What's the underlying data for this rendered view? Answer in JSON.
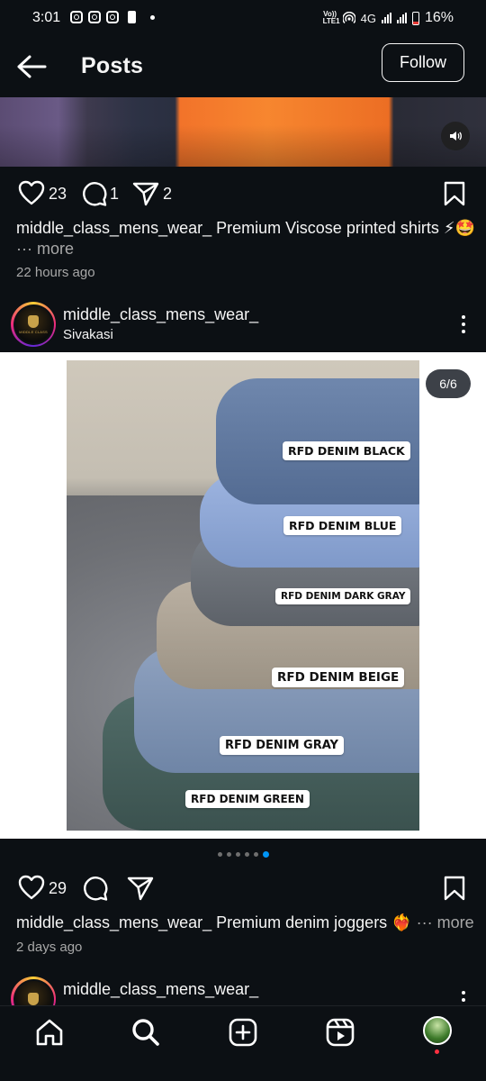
{
  "status_bar": {
    "time": "3:01",
    "network": "4G",
    "battery": "16%",
    "volte_label": "Vo)) LTE1"
  },
  "header": {
    "title": "Posts",
    "follow_label": "Follow"
  },
  "post1": {
    "likes": "23",
    "comments": "1",
    "shares": "2",
    "caption_user": "middle_class_mens_wear_",
    "caption_text": " Premium Viscose printed shirts ⚡🤩",
    "more_label": "··· more",
    "time_ago": "22 hours ago"
  },
  "post2": {
    "username": "middle_class_mens_wear_",
    "location": "Sivakasi",
    "counter": "6/6",
    "labels": [
      "RFD DENIM BLACK",
      "RFD DENIM BLUE",
      "RFD DENIM DARK GRAY",
      "RFD DENIM BEIGE",
      "RFD DENIM GRAY",
      "RFD DENIM GREEN"
    ],
    "likes": "29",
    "caption_user": "middle_class_mens_wear_",
    "caption_text": " Premium denim joggers ❤️‍🔥",
    "more_label": "··· more",
    "time_ago": "2 days ago",
    "carousel_total": 6,
    "carousel_active": 6
  },
  "post3": {
    "username": "middle_class_mens_wear_"
  },
  "logo_text": "MIDDLE CLASS",
  "icons": [
    "back-arrow-icon",
    "speaker-icon",
    "heart-icon",
    "comment-icon",
    "share-icon",
    "bookmark-icon",
    "more-icon",
    "home-icon",
    "search-icon",
    "create-icon",
    "reels-icon",
    "profile-avatar"
  ],
  "colors": {
    "background": "#0c1014",
    "accent": "#0095f6",
    "muted": "#a8a8a8"
  }
}
